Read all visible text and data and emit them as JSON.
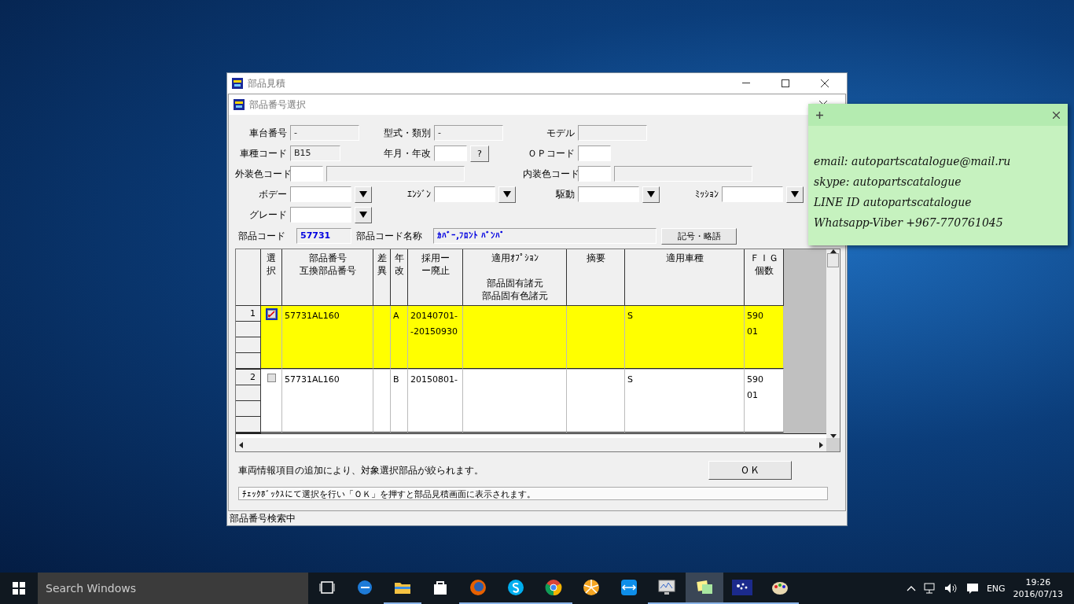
{
  "outer_window": {
    "title": "部品見積",
    "status": "部品番号検索中"
  },
  "dialog": {
    "title": "部品番号選択",
    "form_rows": [
      [
        {
          "label": "車台番号",
          "controls": [
            {
              "kind": "display",
              "value": "-"
            }
          ]
        },
        {
          "label": "型式・類別",
          "controls": [
            {
              "kind": "display",
              "value": "-"
            }
          ]
        },
        {
          "label": "モデル",
          "controls": [
            {
              "kind": "display"
            }
          ]
        }
      ],
      [
        {
          "label": "車種コード",
          "controls": [
            {
              "kind": "display",
              "value": "B15"
            }
          ]
        },
        {
          "label": "年月・年改",
          "controls": [
            {
              "kind": "input"
            },
            {
              "kind": "help",
              "value": "?"
            }
          ]
        },
        {
          "label": "ＯＰコード",
          "controls": [
            {
              "kind": "input"
            }
          ]
        }
      ],
      [
        {
          "label": "外装色コード",
          "controls": [
            {
              "kind": "input"
            },
            {
              "kind": "wide"
            }
          ]
        },
        {
          "label": "内装色コード",
          "controls": [
            {
              "kind": "input"
            },
            {
              "kind": "wide"
            }
          ]
        }
      ],
      [
        {
          "label": "ボデー",
          "controls": [
            {
              "kind": "combo"
            }
          ]
        },
        {
          "label": "ｴﾝｼﾞﾝ",
          "controls": [
            {
              "kind": "combo"
            }
          ]
        },
        {
          "label": "駆動",
          "controls": [
            {
              "kind": "combo"
            }
          ]
        },
        {
          "label": "ﾐｯｼｮﾝ",
          "controls": [
            {
              "kind": "combo"
            }
          ]
        }
      ],
      [
        {
          "label": "グレード",
          "controls": [
            {
              "kind": "combo"
            }
          ]
        }
      ]
    ],
    "part_code": {
      "label": "部品コード",
      "value": "57731"
    },
    "part_name": {
      "label": "部品コード名称",
      "value": "ｶﾊﾞｰ,ﾌﾛﾝﾄ ﾊﾞﾝﾊﾟ"
    },
    "symbols_button": "記号・略語",
    "table": {
      "select_column": {
        "labels": [
          "選択"
        ]
      },
      "columns": [
        {
          "labels": [
            "部品番号",
            "互換部品番号"
          ]
        },
        {
          "labels": [
            "差異"
          ]
        },
        {
          "labels": [
            "年改"
          ]
        },
        {
          "labels": [
            "採用ー",
            "ー廃止"
          ]
        },
        {
          "labels": [
            "適用ｵﾌﾟｼｮﾝ",
            "部品固有諸元",
            "部品固有色諸元"
          ]
        },
        {
          "labels": [
            "摘要"
          ]
        },
        {
          "labels": [
            "適用車種"
          ]
        },
        {
          "labels": [
            "ＦＩＧ",
            "個数"
          ]
        }
      ],
      "rows": [
        {
          "number": "1",
          "checked": true,
          "selected": true,
          "cells": [
            [
              "57731AL160"
            ],
            [],
            [
              "A"
            ],
            [
              "20140701-",
              "-20150930"
            ],
            [],
            [],
            [
              "S"
            ],
            [
              "590",
              "01"
            ]
          ]
        },
        {
          "number": "2",
          "checked": false,
          "selected": false,
          "cells": [
            [
              "57731AL160"
            ],
            [],
            [
              "B"
            ],
            [
              "20150801-"
            ],
            [],
            [],
            [
              "S"
            ],
            [
              "590",
              "01"
            ]
          ]
        }
      ]
    },
    "message": "車両情報項目の追加により、対象選択部品が絞られます。",
    "ok_button": "ＯＫ",
    "status": "ﾁｪｯｸﾎﾞｯｸｽにて選択を行い「ＯＫ」を押すと部品見積画面に表示されます。"
  },
  "sticky_note": {
    "lines": [
      "email: autopartscatalogue@mail.ru",
      "skype: autopartscatalogue",
      "LINE ID autopartscatalogue",
      "Whatsapp-Viber +967-770761045"
    ]
  },
  "taskbar": {
    "search_placeholder": "Search Windows",
    "apps": [
      {
        "kind": "taskview",
        "running": false,
        "active": false
      },
      {
        "kind": "edge",
        "running": false,
        "active": false
      },
      {
        "kind": "folder",
        "running": true,
        "active": false
      },
      {
        "kind": "store",
        "running": false,
        "active": false
      },
      {
        "kind": "firefox",
        "running": true,
        "active": false
      },
      {
        "kind": "skype",
        "running": true,
        "active": false
      },
      {
        "kind": "chrome",
        "running": true,
        "active": false
      },
      {
        "kind": "fan",
        "running": false,
        "active": false
      },
      {
        "kind": "teamviewer",
        "running": false,
        "active": false
      },
      {
        "kind": "monitor",
        "running": true,
        "active": false
      },
      {
        "kind": "notes",
        "running": true,
        "active": true
      },
      {
        "kind": "stars",
        "running": true,
        "active": false
      },
      {
        "kind": "paint",
        "running": true,
        "active": false
      }
    ],
    "language": "ENG",
    "time": "19:26",
    "date": "2016/07/13"
  }
}
